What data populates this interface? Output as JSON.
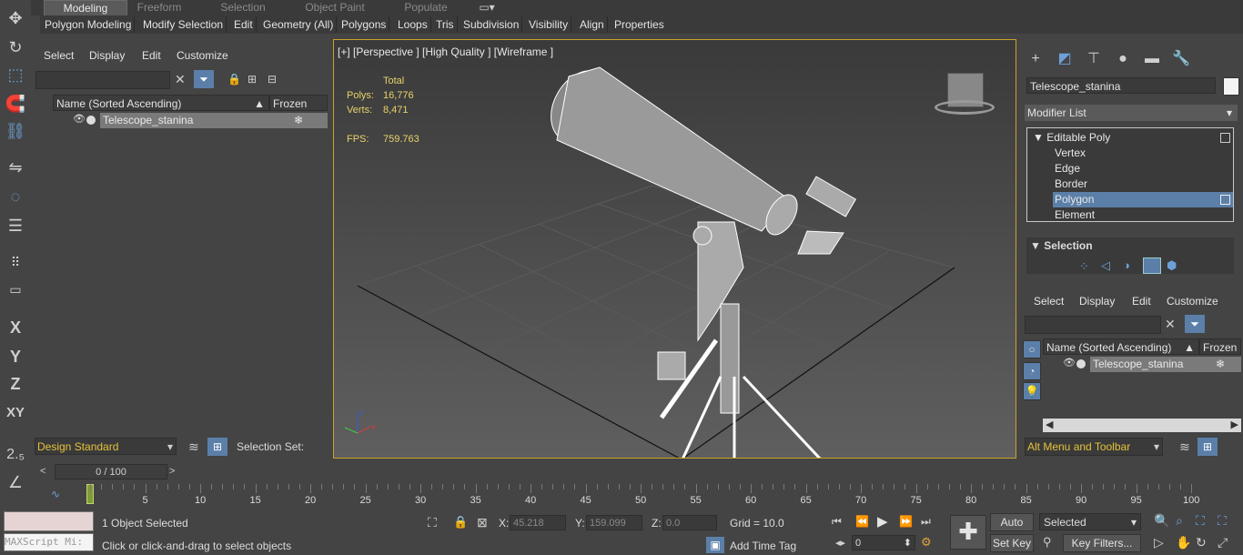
{
  "ribbon": {
    "tabs": [
      "Modeling",
      "Freeform",
      "Selection",
      "Object Paint",
      "Populate"
    ],
    "sub": [
      "Polygon Modeling",
      "Modify Selection",
      "Edit",
      "Geometry (All)",
      "Polygons",
      "Loops",
      "Tris",
      "Subdivision",
      "Visibility",
      "Align",
      "Properties"
    ]
  },
  "left_explorer": {
    "menu": [
      "Select",
      "Display",
      "Edit",
      "Customize"
    ],
    "col_name": "Name (Sorted Ascending)",
    "col_frozen": "Frozen",
    "row_name": "Telescope_stanina",
    "layer": "Design Standard",
    "selection_set": "Selection Set:"
  },
  "viewport": {
    "label": "[+] [Perspective ] [High Quality ] [Wireframe ]",
    "total_label": "Total",
    "polys_label": "Polys:",
    "polys_value": "16,776",
    "verts_label": "Verts:",
    "verts_value": "8,471",
    "fps_label": "FPS:",
    "fps_value": "759.763"
  },
  "command_panel": {
    "object_name": "Telescope_stanina",
    "modifier_list": "Modifier List",
    "stack": [
      "Editable Poly",
      "Vertex",
      "Edge",
      "Border",
      "Polygon",
      "Element"
    ],
    "selection_rollout": "Selection"
  },
  "right_explorer": {
    "menu": [
      "Select",
      "Display",
      "Edit",
      "Customize"
    ],
    "col_name": "Name (Sorted Ascending)",
    "col_frozen": "Frozen",
    "row_name": "Telescope_stanina",
    "menu_toolbar": "Alt Menu and Toolbar"
  },
  "timeline": {
    "frame": "0 / 100",
    "ticks": [
      "5",
      "10",
      "15",
      "20",
      "25",
      "30",
      "35",
      "40",
      "45",
      "50",
      "55",
      "60",
      "65",
      "70",
      "75",
      "80",
      "85",
      "90",
      "95",
      "100"
    ]
  },
  "status": {
    "maxscript": "MAXScript Mi:",
    "objects_selected": "1 Object Selected",
    "prompt": "Click or click-and-drag to select objects",
    "x_label": "X:",
    "x_value": "45.218",
    "y_label": "Y:",
    "y_value": "159.099",
    "z_label": "Z:",
    "z_value": "0.0",
    "grid": "Grid = 10.0",
    "add_time_tag": "Add Time Tag",
    "auto_key": "Auto Key",
    "set_key": "Set Key",
    "key_mode": "Selected",
    "key_filters": "Key Filters...",
    "frame_value": "0"
  },
  "colors": {
    "accent": "#5b7fa8",
    "viewport_border": "#c9a227",
    "stats": "#e8d36a"
  }
}
